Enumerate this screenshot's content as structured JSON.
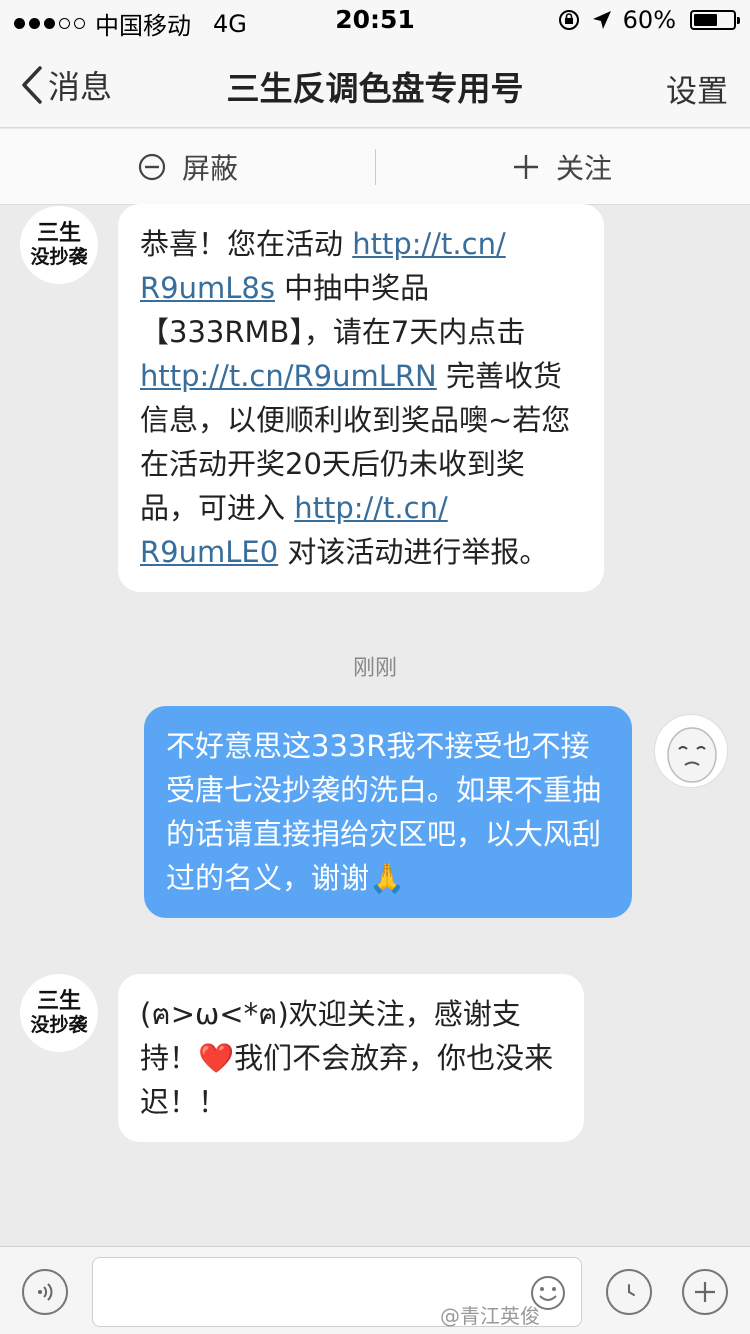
{
  "status_bar": {
    "carrier": "中国移动",
    "network": "4G",
    "time": "20:51",
    "battery": "60%",
    "battery_level": 0.6
  },
  "nav": {
    "back_label": "消息",
    "title": "三生反调色盘专用号",
    "settings_label": "设置"
  },
  "actions": {
    "block_label": "屏蔽",
    "follow_label": "关注"
  },
  "sender_avatar": {
    "line1": "三生",
    "line2": "没抄袭"
  },
  "messages": {
    "m1": {
      "t1": "恭喜！您在活动 ",
      "link1a": "http://t.cn/",
      "link1b": "R9umL8s",
      "t2": " 中抽中奖品【333RMB】，请在7天内点击 ",
      "link2": "http://t.cn/R9umLRN",
      "t3": " 完善收货信息，以便顺利收到奖品噢~若您在活动开奖20天后仍未收到奖品，可进入 ",
      "link3a": "http://t.cn/",
      "link3b": "R9umLE0",
      "t4": " 对该活动进行举报。"
    },
    "timestamp": "刚刚",
    "m2": "不好意思这333R我不接受也不接受唐七没抄袭的洗白。如果不重抽的话请直接捐给灾区吧，以大风刮过的名义，谢谢🙏",
    "m3": "(ฅ>ω<*ฅ)欢迎关注，感谢支持！❤️我们不会放弃，你也没来迟！！"
  },
  "watermark": "@青江英俊",
  "colors": {
    "outgoing_bubble": "#5aa6f5",
    "link": "#386e9c",
    "background": "#ebebeb"
  }
}
